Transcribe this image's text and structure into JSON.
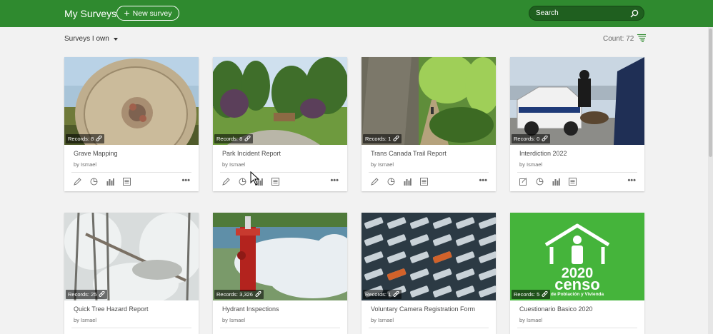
{
  "header": {
    "title": "My Surveys",
    "new_survey_label": "New survey",
    "search_placeholder": "Search",
    "accent": "#2f8a2f"
  },
  "toolbar": {
    "filter_label": "Surveys I own",
    "count_label": "Count: 72"
  },
  "cards": [
    {
      "title": "Grave Mapping",
      "owner": "by Ismael",
      "records": "Records: 8"
    },
    {
      "title": "Park Incident Report",
      "owner": "by Ismael",
      "records": "Records: 8"
    },
    {
      "title": "Trans Canada Trail Report",
      "owner": "by Ismael",
      "records": "Records: 1"
    },
    {
      "title": "Interdiction 2022",
      "owner": "by Ismael",
      "records": "Records: 0"
    },
    {
      "title": "Quick Tree Hazard Report",
      "owner": "by Ismael",
      "records": "Records: 25"
    },
    {
      "title": "Hydrant Inspections",
      "owner": "by Ismael",
      "records": "Records: 3,326"
    },
    {
      "title": "Voluntary Camera Registration Form",
      "owner": "by Ismael",
      "records": "Records: 1"
    },
    {
      "title": "Cuestionario Basico 2020",
      "owner": "by Ismael",
      "records": "Records: 5"
    }
  ],
  "censo_logo": {
    "year": "2020",
    "word": "censo",
    "sub": "de Población y Vivienda"
  },
  "icons": {
    "card_actions": [
      "pencil-icon",
      "analyze-icon",
      "data-chart-icon",
      "form-icon",
      "more-icon"
    ],
    "record_link": "link-icon"
  }
}
